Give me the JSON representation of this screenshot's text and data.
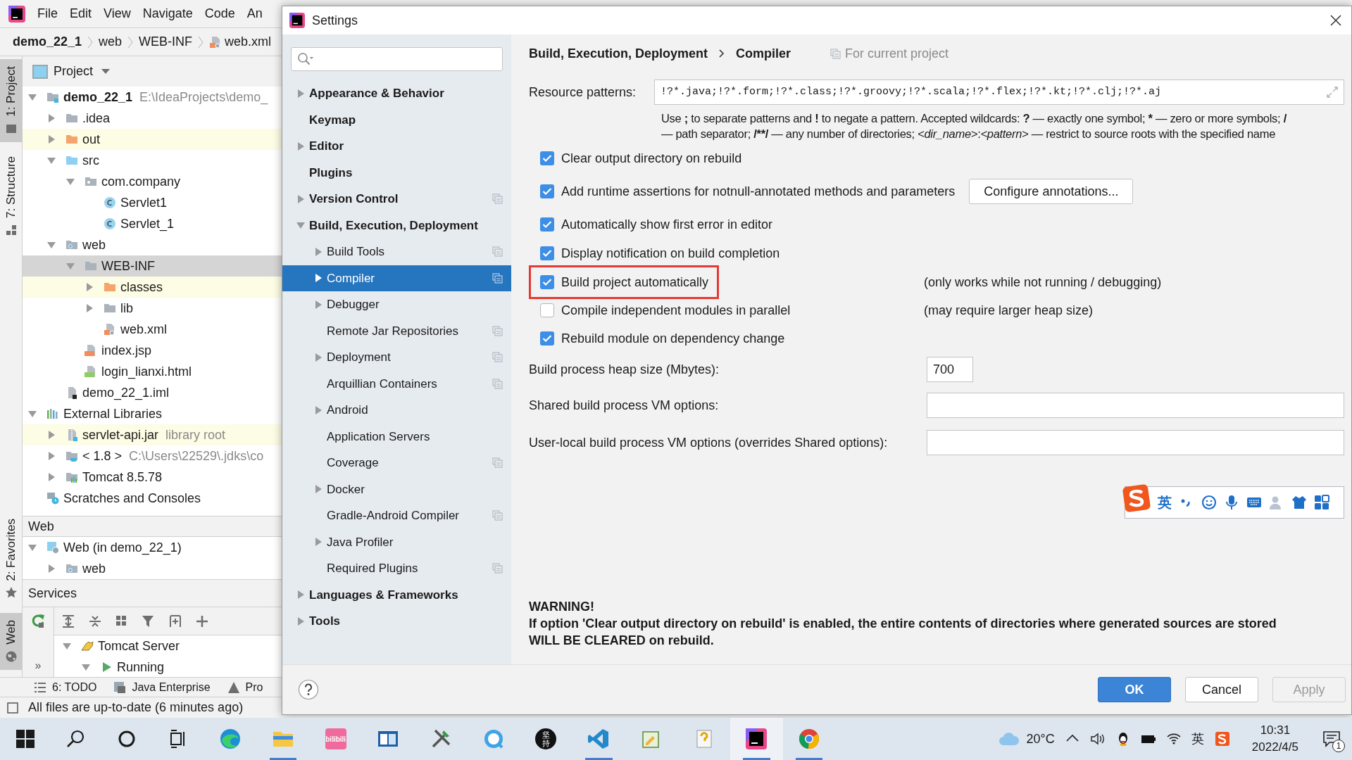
{
  "ide": {
    "menu": [
      "File",
      "Edit",
      "View",
      "Navigate",
      "Code",
      "An"
    ],
    "breadcrumb": [
      {
        "label": "demo_22_1",
        "kind": "module"
      },
      {
        "label": "web",
        "kind": "folder"
      },
      {
        "label": "WEB-INF",
        "kind": "folder"
      },
      {
        "label": "web.xml",
        "kind": "xml"
      }
    ],
    "top_tools": [
      {
        "label": "1: Project",
        "kind": "project",
        "selected": true
      },
      {
        "label": "7: Structure",
        "kind": "structure",
        "selected": false
      }
    ],
    "bottom_tools": [
      {
        "label": "2: Favorites",
        "kind": "favorites",
        "selected": false
      },
      {
        "label": "Web",
        "kind": "web",
        "selected": true
      }
    ],
    "project_panel": {
      "title": "Project",
      "tree": [
        {
          "label": "demo_22_1",
          "kind": "module",
          "note": "E:\\IdeaProjects\\demo_",
          "expanded": true,
          "selected": false,
          "highlighted": false,
          "children": [
            {
              "label": ".idea",
              "kind": "folder",
              "expanded": false,
              "selected": false,
              "highlighted": false
            },
            {
              "label": "out",
              "kind": "folder-excluded",
              "expanded": false,
              "selected": false,
              "highlighted": true
            },
            {
              "label": "src",
              "kind": "folder-source",
              "expanded": true,
              "selected": false,
              "highlighted": false,
              "children": [
                {
                  "label": "com.company",
                  "kind": "package",
                  "expanded": true,
                  "selected": false,
                  "highlighted": false,
                  "children": [
                    {
                      "label": "Servlet1",
                      "kind": "class",
                      "selected": false,
                      "highlighted": false
                    },
                    {
                      "label": "Servlet_1",
                      "kind": "class",
                      "selected": false,
                      "highlighted": false
                    }
                  ]
                }
              ]
            },
            {
              "label": "web",
              "kind": "web-folder",
              "expanded": true,
              "selected": false,
              "highlighted": false,
              "children": [
                {
                  "label": "WEB-INF",
                  "kind": "folder",
                  "expanded": true,
                  "selected": true,
                  "children": [
                    {
                      "label": "classes",
                      "kind": "folder-excluded",
                      "expanded": false,
                      "selected": false,
                      "highlighted": true
                    },
                    {
                      "label": "lib",
                      "kind": "folder",
                      "expanded": false,
                      "selected": false,
                      "highlighted": false
                    },
                    {
                      "label": "web.xml",
                      "kind": "xml",
                      "selected": false,
                      "highlighted": false
                    }
                  ]
                },
                {
                  "label": "index.jsp",
                  "kind": "jsp",
                  "selected": false,
                  "highlighted": false
                },
                {
                  "label": "login_lianxi.html",
                  "kind": "html",
                  "selected": false,
                  "highlighted": false
                }
              ]
            },
            {
              "label": "demo_22_1.iml",
              "kind": "iml",
              "selected": false,
              "highlighted": false
            }
          ]
        },
        {
          "label": "External Libraries",
          "kind": "libraries",
          "expanded": true,
          "selected": false,
          "highlighted": false,
          "children": [
            {
              "label": "servlet-api.jar",
              "kind": "jar",
              "note": "library root",
              "expanded": false,
              "selected": false,
              "highlighted": true
            },
            {
              "label": "< 1.8 >",
              "kind": "jdk",
              "note": "C:\\Users\\22529\\.jdks\\co",
              "expanded": false,
              "selected": false,
              "highlighted": false
            },
            {
              "label": "Tomcat 8.5.78",
              "kind": "tomcat-lib",
              "expanded": false,
              "selected": false,
              "highlighted": false
            }
          ]
        },
        {
          "label": "Scratches and Consoles",
          "kind": "scratches",
          "selected": false,
          "highlighted": false
        }
      ]
    },
    "web_panel": {
      "title": "Web",
      "tree": [
        {
          "label": "Web (in demo_22_1)",
          "kind": "web-facet",
          "expanded": true,
          "selected": false,
          "highlighted": false,
          "children": [
            {
              "label": "web",
              "kind": "web-folder",
              "expanded": false,
              "selected": false,
              "highlighted": false
            }
          ]
        }
      ]
    },
    "services_panel": {
      "title": "Services",
      "more": "»",
      "tree": [
        {
          "label": "Tomcat Server",
          "kind": "tomcat-server",
          "expanded": true,
          "selected": false,
          "highlighted": false,
          "children": [
            {
              "label": "Running",
              "kind": "run",
              "expanded": true,
              "selected": false,
              "highlighted": false
            }
          ]
        }
      ]
    },
    "bottom_tabs": [
      {
        "label": "6: TODO",
        "kind": "todo"
      },
      {
        "label": "Java Enterprise",
        "kind": "enterprise"
      },
      {
        "label": "Pro",
        "kind": "problems"
      }
    ],
    "status": "All files are up-to-date (6 minutes ago)"
  },
  "settings": {
    "title": "Settings",
    "nav": [
      {
        "label": "Appearance & Behavior",
        "expanded": false,
        "selected": false,
        "project_scoped": false
      },
      {
        "label": "Keymap",
        "selected": false,
        "project_scoped": false
      },
      {
        "label": "Editor",
        "expanded": false,
        "selected": false,
        "project_scoped": false
      },
      {
        "label": "Plugins",
        "selected": false,
        "project_scoped": false
      },
      {
        "label": "Version Control",
        "expanded": false,
        "selected": false,
        "project_scoped": true
      },
      {
        "label": "Build, Execution, Deployment",
        "expanded": true,
        "selected": false,
        "project_scoped": false,
        "children": [
          {
            "label": "Build Tools",
            "expanded": false,
            "selected": false,
            "project_scoped": true
          },
          {
            "label": "Compiler",
            "expanded": false,
            "selected": true,
            "project_scoped": true
          },
          {
            "label": "Debugger",
            "expanded": false,
            "selected": false,
            "project_scoped": false
          },
          {
            "label": "Remote Jar Repositories",
            "selected": false,
            "project_scoped": true
          },
          {
            "label": "Deployment",
            "expanded": false,
            "selected": false,
            "project_scoped": true
          },
          {
            "label": "Arquillian Containers",
            "selected": false,
            "project_scoped": true
          },
          {
            "label": "Android",
            "expanded": false,
            "selected": false,
            "project_scoped": false
          },
          {
            "label": "Application Servers",
            "selected": false,
            "project_scoped": false
          },
          {
            "label": "Coverage",
            "selected": false,
            "project_scoped": true
          },
          {
            "label": "Docker",
            "expanded": false,
            "selected": false,
            "project_scoped": false
          },
          {
            "label": "Gradle-Android Compiler",
            "selected": false,
            "project_scoped": true
          },
          {
            "label": "Java Profiler",
            "expanded": false,
            "selected": false,
            "project_scoped": false
          },
          {
            "label": "Required Plugins",
            "selected": false,
            "project_scoped": true
          }
        ]
      },
      {
        "label": "Languages & Frameworks",
        "expanded": false,
        "selected": false,
        "project_scoped": false
      },
      {
        "label": "Tools",
        "expanded": false,
        "selected": false,
        "project_scoped": false
      }
    ],
    "breadcrumb": [
      "Build, Execution, Deployment",
      "Compiler"
    ],
    "scope_note": "For current project",
    "resource_patterns": {
      "label": "Resource patterns:",
      "value": "!?*.java;!?*.form;!?*.class;!?*.groovy;!?*.scala;!?*.flex;!?*.kt;!?*.clj;!?*.aj"
    },
    "hint": [
      [
        {
          "text": "Use ",
          "kind": "plain"
        },
        {
          "text": ";",
          "kind": "bold"
        },
        {
          "text": " to separate patterns and ",
          "kind": "plain"
        },
        {
          "text": "!",
          "kind": "bold"
        },
        {
          "text": " to negate a pattern. Accepted wildcards: ",
          "kind": "plain"
        },
        {
          "text": "?",
          "kind": "bold"
        },
        {
          "text": " — exactly one symbol; ",
          "kind": "plain"
        },
        {
          "text": "*",
          "kind": "bold"
        },
        {
          "text": " — zero or more symbols; ",
          "kind": "plain"
        },
        {
          "text": "/",
          "kind": "bold"
        }
      ],
      [
        {
          "text": "— path separator; ",
          "kind": "plain"
        },
        {
          "text": "/**/",
          "kind": "bold"
        },
        {
          "text": " — any number of directories; ",
          "kind": "plain"
        },
        {
          "text": "<dir_name>",
          "kind": "italic"
        },
        {
          "text": ":",
          "kind": "plain"
        },
        {
          "text": "<pattern>",
          "kind": "italic"
        },
        {
          "text": " — restrict to source roots with the specified name",
          "kind": "plain"
        }
      ]
    ],
    "options": [
      {
        "label": "Clear output directory on rebuild",
        "checked": true,
        "highlighted": false
      },
      {
        "label": "Add runtime assertions for notnull-annotated methods and parameters",
        "checked": true,
        "highlighted": false,
        "button": "Configure annotations..."
      },
      {
        "label": "Automatically show first error in editor",
        "checked": true,
        "highlighted": false
      },
      {
        "label": "Display notification on build completion",
        "checked": true,
        "highlighted": false
      },
      {
        "label": "Build project automatically",
        "checked": true,
        "highlighted": true,
        "note": "(only works while not running / debugging)"
      },
      {
        "label": "Compile independent modules in parallel",
        "checked": false,
        "highlighted": false,
        "note": "(may require larger heap size)"
      },
      {
        "label": "Rebuild module on dependency change",
        "checked": true,
        "highlighted": false
      }
    ],
    "fields": [
      {
        "label": "Build process heap size (Mbytes):",
        "value": "700",
        "kind": "short"
      },
      {
        "label": "Shared build process VM options:",
        "kind": "wide"
      },
      {
        "label": "User-local build process VM options (overrides Shared options):",
        "kind": "wide"
      }
    ],
    "ime": {
      "mode": "英"
    },
    "warning": {
      "title": "WARNING!",
      "text": "If option 'Clear output directory on rebuild' is enabled, the entire contents of directories where generated sources are stored WILL BE CLEARED on rebuild."
    },
    "buttons": [
      {
        "label": "OK",
        "kind": "primary"
      },
      {
        "label": "Cancel",
        "kind": "normal"
      },
      {
        "label": "Apply",
        "kind": "disabled"
      }
    ]
  },
  "taskbar": {
    "apps": [
      {
        "kind": "edge",
        "running": false
      },
      {
        "kind": "explorer",
        "running": true
      },
      {
        "kind": "bilibili",
        "label": "bilibili",
        "running": false
      },
      {
        "kind": "window",
        "running": false
      },
      {
        "kind": "tools",
        "running": false
      },
      {
        "kind": "browser",
        "running": false
      },
      {
        "kind": "badge",
        "label": "坚持",
        "running": false
      },
      {
        "kind": "vscode",
        "running": true
      },
      {
        "kind": "notepad",
        "running": false
      },
      {
        "kind": "help",
        "running": false
      },
      {
        "kind": "idea",
        "running": true
      },
      {
        "kind": "chrome",
        "running": true
      }
    ],
    "temperature": "20°C",
    "input_mode": "英",
    "time": "10:31",
    "date": "2022/4/5",
    "notifications": "1"
  }
}
